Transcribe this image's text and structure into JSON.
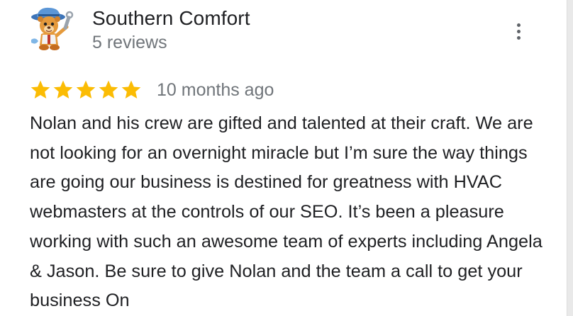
{
  "reviewer": {
    "name": "Southern Comfort",
    "review_count": "5 reviews",
    "avatar_icon": "cartoon-bear-mascot-icon"
  },
  "menu": {
    "icon": "more-vert-icon"
  },
  "review": {
    "rating": 5,
    "max_rating": 5,
    "star_color": "#fbbc04",
    "date": "10 months ago",
    "text": "Nolan and his crew are gifted and talented at their craft. We are not looking for an overnight miracle but I’m sure the way things are going our business is destined for greatness with HVAC webmasters at the controls of our SEO. It’s been a pleasure working with such an awesome team of experts including Angela & Jason. Be sure to give Nolan and the team a call to get your business On"
  }
}
